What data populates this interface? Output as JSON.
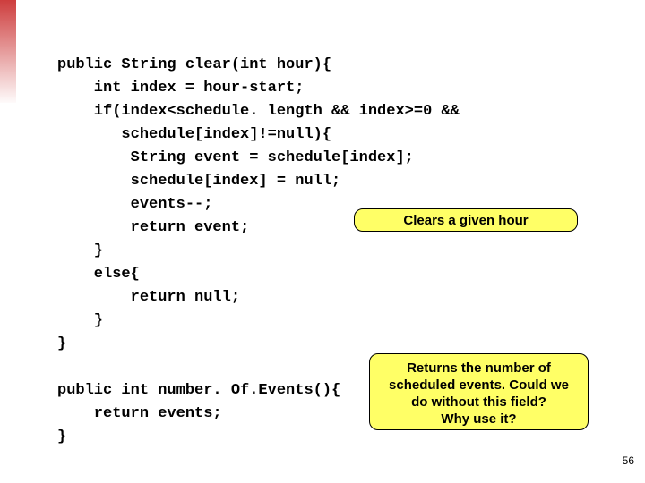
{
  "code": {
    "l1": "public String clear(int hour){",
    "l2": "    int index = hour-start;",
    "l3": "    if(index<schedule. length && index>=0 &&",
    "l4": "       schedule[index]!=null){",
    "l5": "        String event = schedule[index];",
    "l6": "        schedule[index] = null;",
    "l7": "        events--;",
    "l8": "        return event;",
    "l9": "    }",
    "l10": "    else{",
    "l11": "        return null;",
    "l12": "    }",
    "l13": "}",
    "l14": "",
    "l15": "public int number. Of.Events(){",
    "l16": "    return events;",
    "l17": "}"
  },
  "callout1": "Clears a given hour",
  "callout2": "Returns the number of\nscheduled events. Could we\ndo without this field?\nWhy use it?",
  "page_number": "56"
}
